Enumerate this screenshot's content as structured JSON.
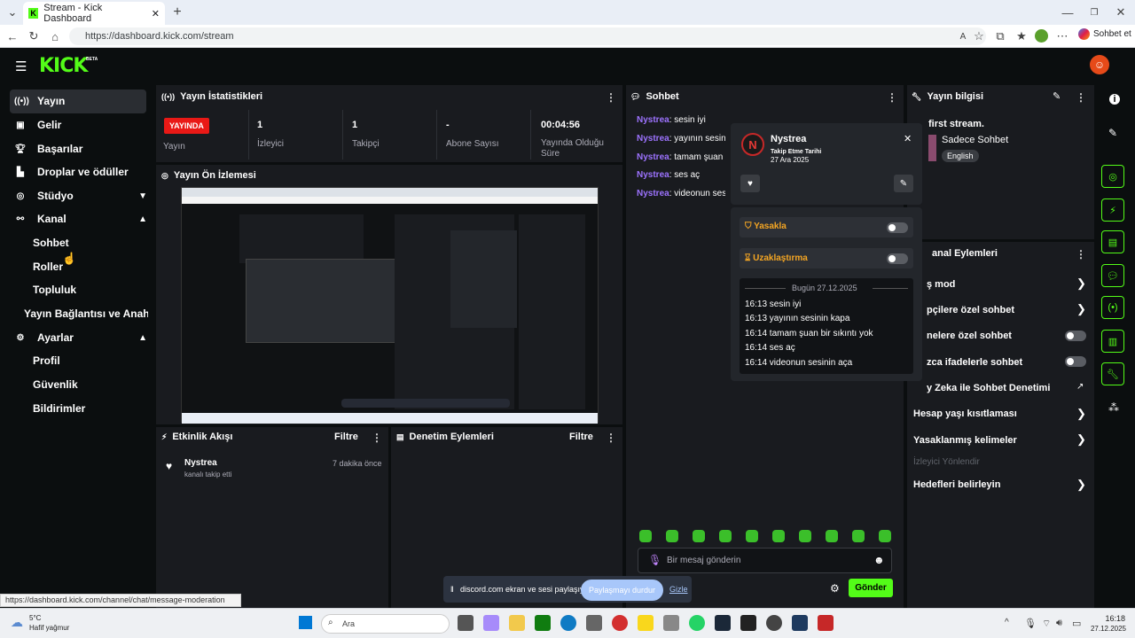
{
  "browser": {
    "tab_title": "Stream - Kick Dashboard",
    "url": "https://dashboard.kick.com/stream",
    "copilot_label": "Sohbet et"
  },
  "app": {
    "logo": "KICK",
    "beta": "BETA"
  },
  "sidebar": {
    "items": [
      {
        "label": "Yayın",
        "icon": "broadcast-icon"
      },
      {
        "label": "Gelir",
        "icon": "money-icon"
      },
      {
        "label": "Başarılar",
        "icon": "trophy-icon"
      },
      {
        "label": "Droplar ve ödüller",
        "icon": "gift-icon"
      },
      {
        "label": "Stüdyo",
        "icon": "studio-icon"
      },
      {
        "label": "Kanal",
        "icon": "channel-icon"
      },
      {
        "label": "Sohbet"
      },
      {
        "label": "Roller"
      },
      {
        "label": "Topluluk"
      },
      {
        "label": "Yayın Bağlantısı ve Anahtarı"
      },
      {
        "label": "Ayarlar",
        "icon": "gear-icon"
      },
      {
        "label": "Profil"
      },
      {
        "label": "Güvenlik"
      },
      {
        "label": "Bildirimler"
      }
    ]
  },
  "stats": {
    "title": "Yayın İstatistikleri",
    "live_badge": "YAYINDA",
    "live_label": "Yayın",
    "viewers_value": "1",
    "viewers_label": "İzleyici",
    "followers_value": "1",
    "followers_label": "Takipçi",
    "subs_value": "-",
    "subs_label": "Abone Sayısı",
    "uptime_value": "00:04:56",
    "uptime_label": "Yayında Olduğu Süre"
  },
  "preview": {
    "title": "Yayın Ön İzlemesi"
  },
  "activity": {
    "title": "Etkinlik Akışı",
    "filter": "Filtre",
    "user": "Nystrea",
    "text": "kanalı takip etti",
    "time": "7 dakika önce"
  },
  "moderation": {
    "title": "Denetim Eylemleri",
    "filter": "Filtre"
  },
  "chat": {
    "title": "Sohbet",
    "messages": [
      {
        "user": "Nystrea",
        "text": ": sesin iyi"
      },
      {
        "user": "Nystrea",
        "text": ": yayının sesinin kapa"
      },
      {
        "user": "Nystrea",
        "text": ": tamam şuan bir sıkıntı yok"
      },
      {
        "user": "Nystrea",
        "text": ": ses aç"
      },
      {
        "user": "Nystrea",
        "text": ": videonun sesinin aça"
      }
    ],
    "placeholder": "Bir mesaj gönderin",
    "send": "Gönder"
  },
  "usercard": {
    "name": "Nystrea",
    "follow_label": "Takip Etme Tarihi",
    "follow_date": "27 Ara 2025",
    "ban": "Yasakla",
    "timeout": "Uzaklaştırma",
    "today": "Bugün 27.12.2025",
    "log": [
      "16:13 sesin iyi",
      "16:13 yayının sesinin kapa",
      "16:14 tamam şuan bir sıkıntı yok",
      "16:14 ses aç",
      "16:14 videonun sesinin aça"
    ]
  },
  "info": {
    "title": "Yayın bilgisi",
    "stream_title": "first stream.",
    "category": "Sadece Sohbet",
    "tag": "English"
  },
  "channel_actions": {
    "title": "anal Eylemleri",
    "rows": [
      {
        "label": "ş mod",
        "type": "chevron"
      },
      {
        "label": "pçilere özel sohbet",
        "type": "chevron"
      },
      {
        "label": "nelere özel sohbet",
        "type": "toggle"
      },
      {
        "label": "zca ifadelerle sohbet",
        "type": "toggle"
      },
      {
        "label": "y Zeka ile Sohbet Denetimi",
        "type": "external"
      },
      {
        "label": "Hesap yaşı kısıtlaması",
        "type": "chevron"
      },
      {
        "label": "Yasaklanmış kelimeler",
        "type": "chevron"
      },
      {
        "label": "İzleyici Yönlendir",
        "type": "disabled"
      },
      {
        "label": "Hedefleri belirleyin",
        "type": "chevron"
      }
    ]
  },
  "share_bar": {
    "text": "discord.com ekran ve sesi paylaşıyor.",
    "stop": "Paylaşmayı durdur",
    "hide": "Gizle"
  },
  "status_url": "https://dashboard.kick.com/channel/chat/message-moderation",
  "taskbar": {
    "temp": "5°C",
    "weather": "Hafif yağmur",
    "search": "Ara",
    "time": "16:18",
    "date": "27.12.2025"
  },
  "colors": {
    "accent": "#53fc18",
    "live": "#e91916",
    "username": "#9d73ff"
  }
}
